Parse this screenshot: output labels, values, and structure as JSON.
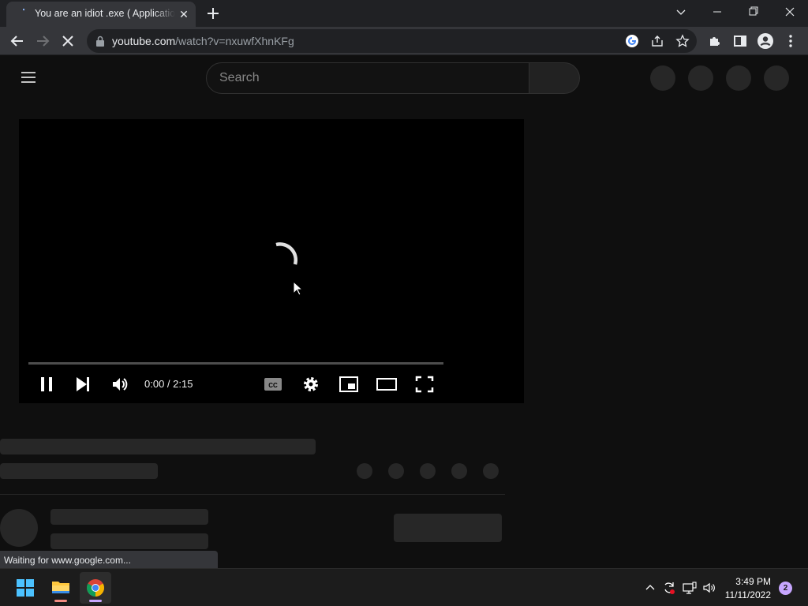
{
  "browser": {
    "tab": {
      "title": "You are an idiot .exe ( Application Error )",
      "close_label": "✕"
    },
    "url_host": "youtube.com",
    "url_path": "/watch?v=nxuwfXhnKFg"
  },
  "youtube": {
    "search": {
      "placeholder": "Search"
    }
  },
  "player": {
    "time": "0:00 / 2:15",
    "progress": 0,
    "state": "loading"
  },
  "status_bar": {
    "text": "Waiting for www.google.com..."
  },
  "taskbar": {
    "clock_time": "3:49 PM",
    "clock_date": "11/11/2022",
    "notification_count": "2"
  },
  "colors": {
    "accent": "#ff0000",
    "chrome_indicator": "#c7a6ff",
    "explorer_indicator": "#f28b82"
  }
}
